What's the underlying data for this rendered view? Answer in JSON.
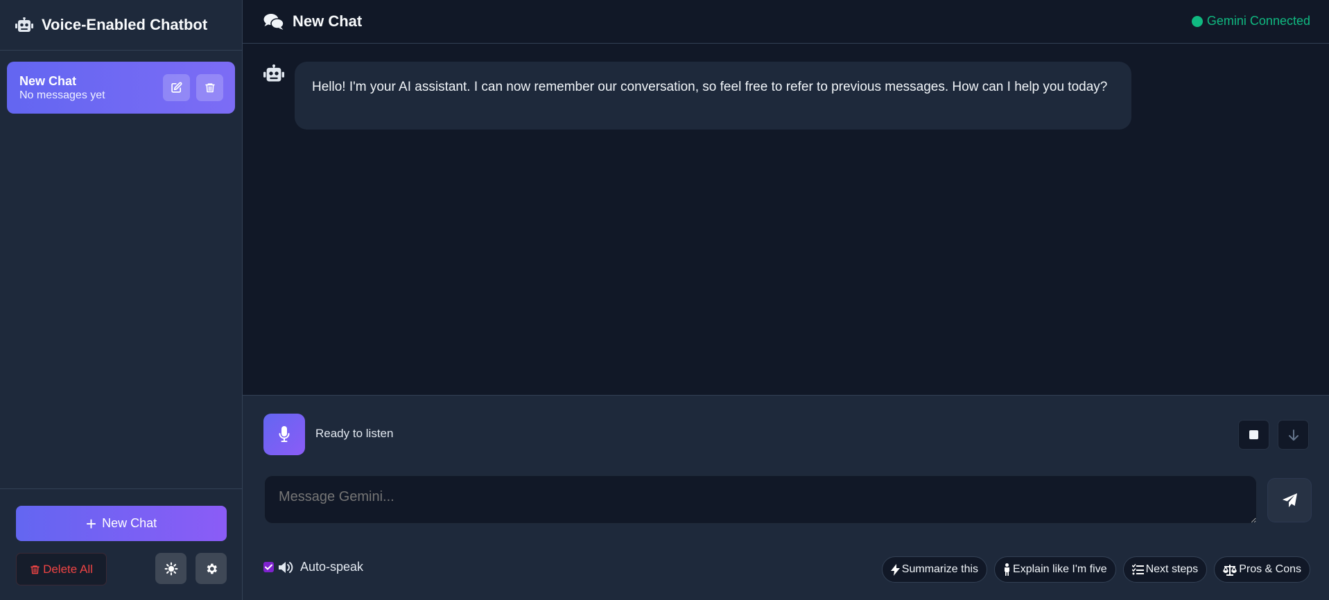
{
  "sidebar": {
    "title": "Voice-Enabled Chatbot",
    "chats": [
      {
        "name": "New Chat",
        "subtitle": "No messages yet"
      }
    ],
    "new_chat_label": "New Chat",
    "delete_all_label": "Delete All"
  },
  "header": {
    "title": "New Chat",
    "status": "Gemini Connected"
  },
  "messages": [
    {
      "role": "assistant",
      "text": "Hello! I'm your AI assistant. I can now remember our conversation, so feel free to refer to previous messages. How can I help you today?"
    }
  ],
  "voice": {
    "status": "Ready to listen"
  },
  "composer": {
    "placeholder": "Message Gemini..."
  },
  "auto_speak": {
    "label": "Auto-speak",
    "checked": true
  },
  "quick_actions": [
    {
      "label": "Summarize this",
      "icon": "bolt-icon"
    },
    {
      "label": "Explain like I'm five",
      "icon": "child-icon"
    },
    {
      "label": "Next steps",
      "icon": "list-check-icon"
    },
    {
      "label": "Pros & Cons",
      "icon": "scale-icon"
    }
  ],
  "colors": {
    "accent": "#6366f1",
    "accent_end": "#8b5cf6",
    "background": "#111827",
    "panel": "#1e293b",
    "status_green": "#10b981",
    "danger": "#ef4444"
  }
}
